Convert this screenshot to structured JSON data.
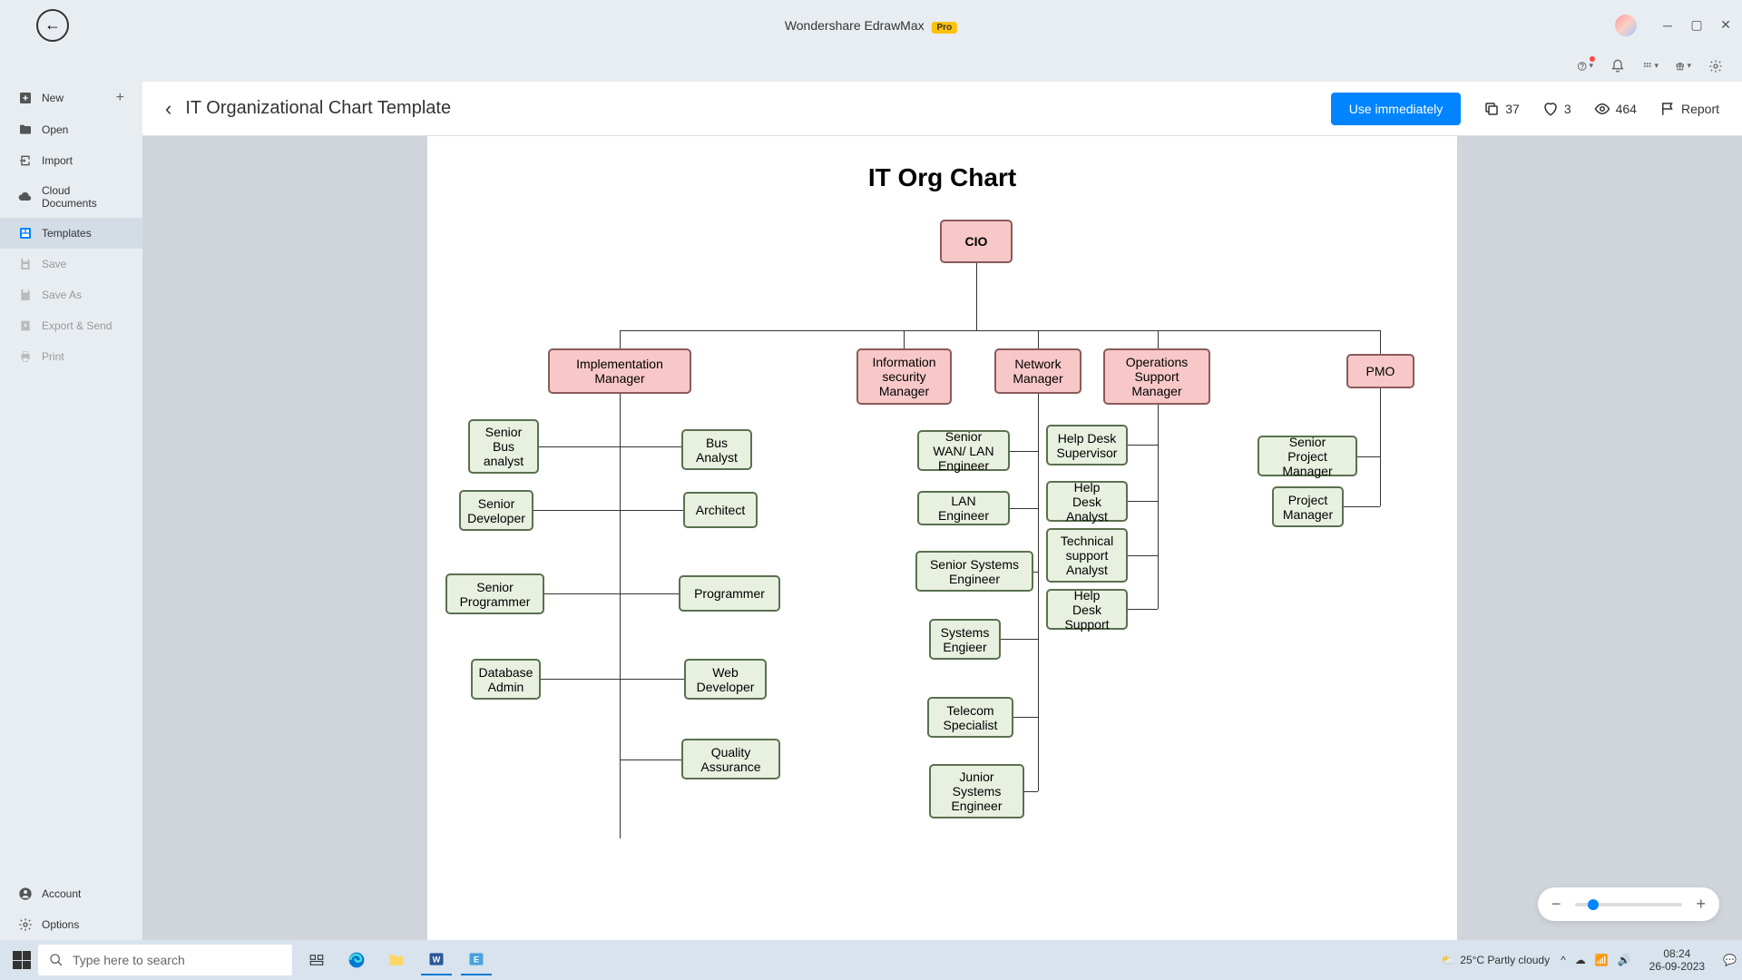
{
  "app": {
    "name": "Wondershare EdrawMax",
    "badge": "Pro"
  },
  "sidebar": {
    "new": "New",
    "open": "Open",
    "import": "Import",
    "cloud": "Cloud Documents",
    "templates": "Templates",
    "save": "Save",
    "saveas": "Save As",
    "export": "Export & Send",
    "print": "Print",
    "account": "Account",
    "options": "Options"
  },
  "header": {
    "title": "IT Organizational Chart Template",
    "use": "Use immediately",
    "copies": "37",
    "likes": "3",
    "views": "464",
    "report": "Report"
  },
  "chart": {
    "title": "IT Org Chart",
    "cio": "CIO",
    "impl": "Implementation Manager",
    "infosec": "Information security Manager",
    "network": "Network Manager",
    "ops": "Operations Support Manager",
    "pmo": "PMO",
    "sba": "Senior Bus analyst",
    "ba": "Bus Analyst",
    "srdev": "Senior Developer",
    "arch": "Architect",
    "srprog": "Senior Programmer",
    "prog": "Programmer",
    "dba": "Database Admin",
    "webdev": "Web Developer",
    "qa": "Quality Assurance",
    "srwan": "Senior WAN/ LAN Engineer",
    "lan": "LAN Engineer",
    "srsys": "Senior Systems Engineer",
    "syseng": "Systems Engieer",
    "telecom": "Telecom Specialist",
    "jrsys": "Junior Systems Engineer",
    "hdsup": "Help Desk Supervisor",
    "hda": "Help Desk Analyst",
    "tsa": "Technical support Analyst",
    "hds": "Help Desk Support",
    "srpm": "Senior Project Manager",
    "pm": "Project Manager"
  },
  "taskbar": {
    "search": "Type here to search",
    "weather": "25°C  Partly cloudy",
    "time": "08:24",
    "date": "26-09-2023"
  }
}
